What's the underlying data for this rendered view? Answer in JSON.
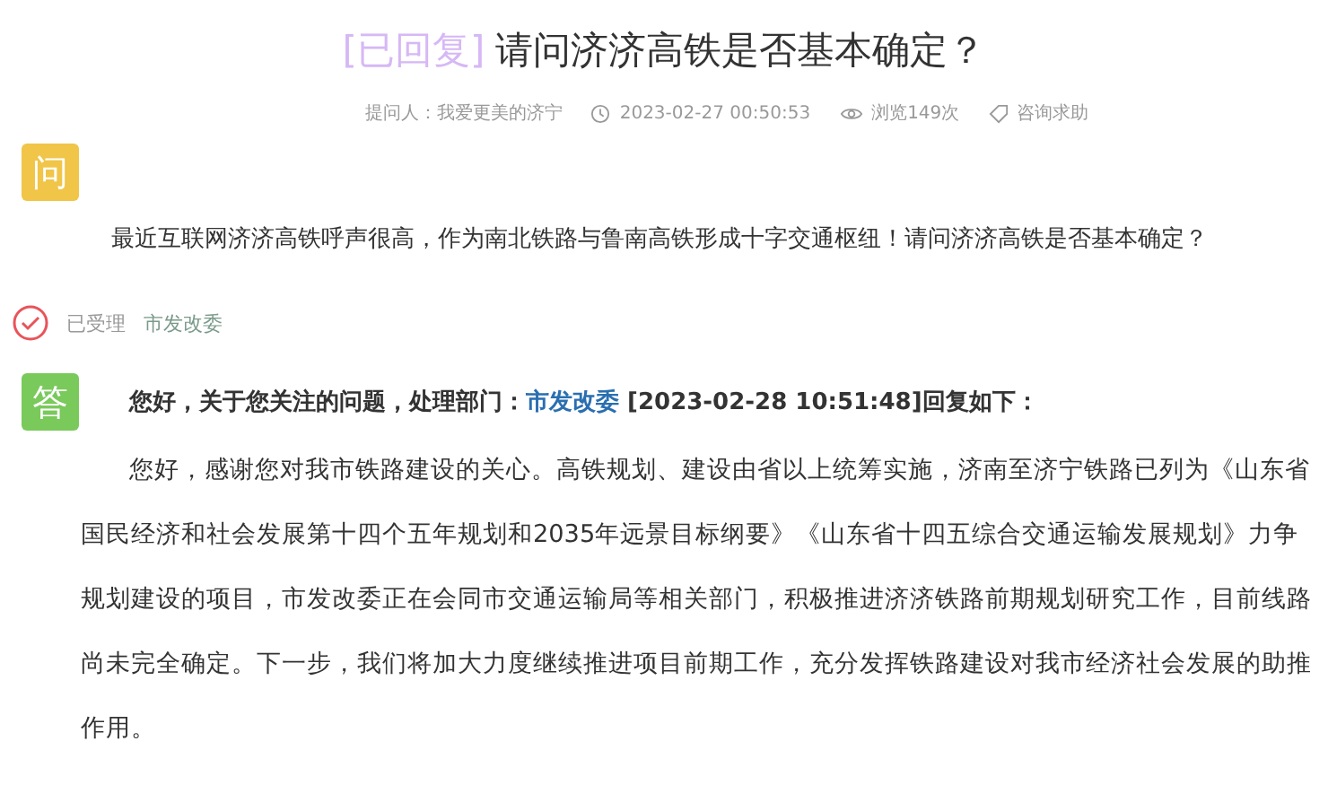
{
  "title": {
    "status": "[已回复]",
    "question": "请问济济高铁是否基本确定？"
  },
  "meta": [
    {
      "kind": "asker",
      "text": "提问人：我爱更美的济宁"
    },
    {
      "kind": "time",
      "text": "2023-02-27 00:50:53"
    },
    {
      "kind": "views",
      "text": "浏览149次"
    },
    {
      "kind": "category",
      "text": "咨询求助"
    }
  ],
  "question": {
    "badge": "问",
    "text": "最近互联网济济高铁呼声很高，作为南北铁路与鲁南高铁形成十字交通枢纽！请问济济高铁是否基本确定？"
  },
  "status": {
    "accepted": true,
    "label": "已受理",
    "department": "市发改委"
  },
  "answer": {
    "badge": "答",
    "intro": "您好，关于您关注的问题，处理部门：",
    "department": "市发改委",
    "suffix": "[2023-02-28 10:51:48]回复如下：",
    "body": "您好，感谢您对我市铁路建设的关心。高铁规划、建设由省以上统筹实施，济南至济宁铁路已列为《山东省国民经济和社会发展第十四个五年规划和2035年远景目标纲要》《山东省十四五综合交通运输发展规划》力争规划建设的项目，市发改委正在会同市交通运输局等相关部门，积极推进济济铁路前期规划研究工作，目前线路尚未完全确定。下一步，我们将加大力度继续推进项目前期工作，充分发挥铁路建设对我市经济社会发展的助推作用。"
  }
}
